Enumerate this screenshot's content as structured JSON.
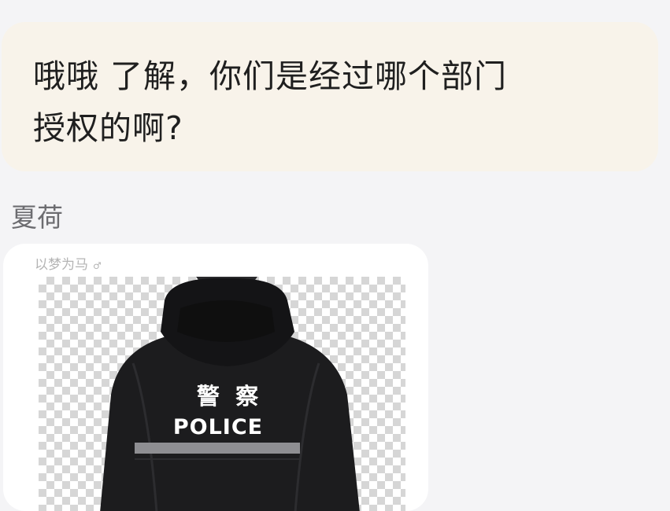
{
  "message_received": {
    "line1": "哦哦 了解，你们是经过哪个部门",
    "line2": "授权的啊?"
  },
  "sender_name": "夏荷",
  "image_message": {
    "watermark": "以梦为马",
    "watermark_mark": "♂",
    "jacket_text_cn": "警  察",
    "jacket_text_en": "POLICE"
  },
  "colors": {
    "page_bg": "#f4f4f6",
    "received_bubble": "#f8f3ea",
    "card_bg": "#ffffff",
    "jacket": "#1c1c1e"
  }
}
